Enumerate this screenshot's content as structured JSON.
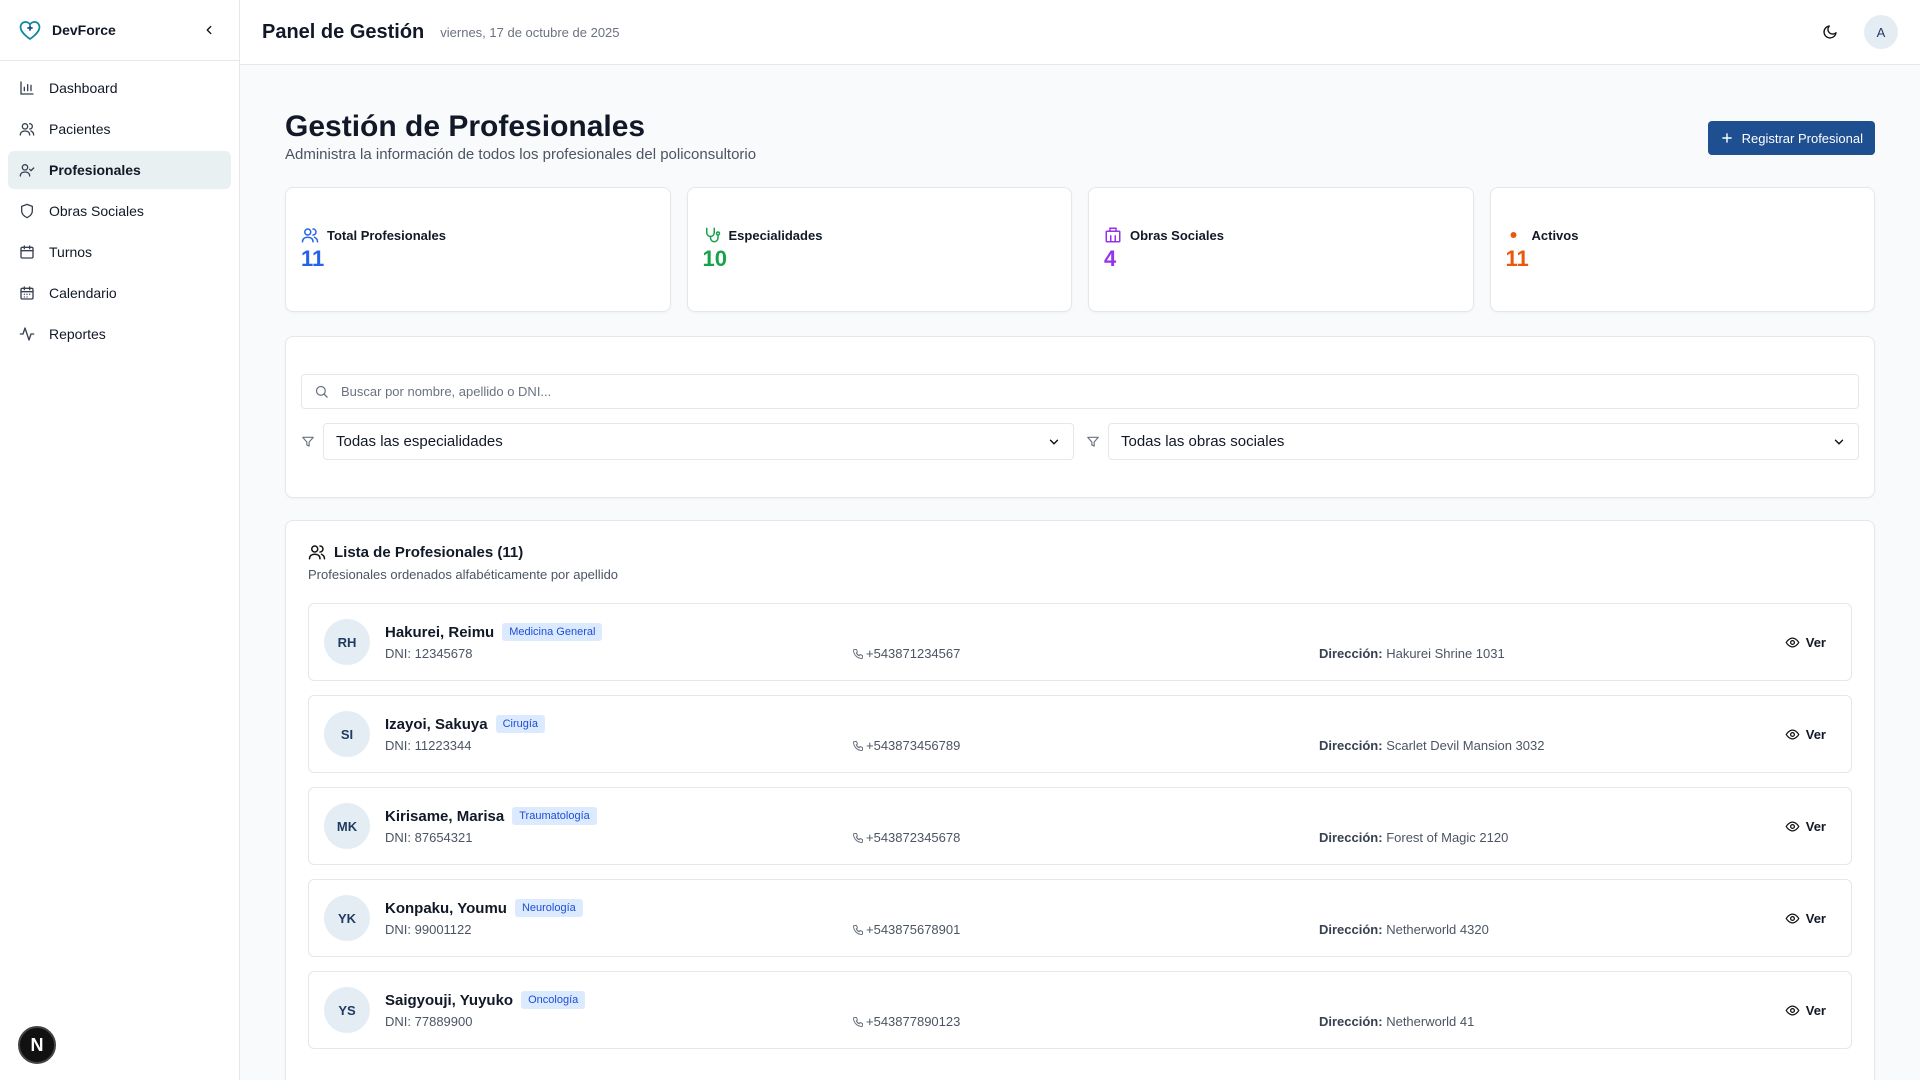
{
  "app": {
    "name": "DevForce"
  },
  "sidebar": {
    "items": [
      {
        "label": "Dashboard",
        "icon": "bar-chart-icon"
      },
      {
        "label": "Pacientes",
        "icon": "users-icon"
      },
      {
        "label": "Profesionales",
        "icon": "user-check-icon",
        "active": true
      },
      {
        "label": "Obras Sociales",
        "icon": "shield-icon"
      },
      {
        "label": "Turnos",
        "icon": "calendar-icon"
      },
      {
        "label": "Calendario",
        "icon": "calendar-days-icon"
      },
      {
        "label": "Reportes",
        "icon": "activity-icon"
      }
    ],
    "fab_label": "N"
  },
  "header": {
    "title": "Panel de Gestión",
    "date": "viernes, 17 de octubre de 2025",
    "avatar": "A"
  },
  "page": {
    "title": "Gestión de Profesionales",
    "subtitle": "Administra la información de todos los profesionales del policonsultorio",
    "primary_button": "Registrar Profesional"
  },
  "stats": [
    {
      "label": "Total Profesionales",
      "value": "11",
      "color": "#2563eb"
    },
    {
      "label": "Especialidades",
      "value": "10",
      "color": "#16a34a"
    },
    {
      "label": "Obras Sociales",
      "value": "4",
      "color": "#9333ea"
    },
    {
      "label": "Activos",
      "value": "11",
      "color": "#ea580c"
    }
  ],
  "filters": {
    "search_placeholder": "Buscar por nombre, apellido o DNI...",
    "specialty": "Todas las especialidades",
    "insurance": "Todas las obras sociales"
  },
  "list": {
    "title": "Lista de Profesionales (11)",
    "subtitle": "Profesionales ordenados alfabéticamente por apellido",
    "dni_label": "DNI:",
    "address_label": "Dirección:",
    "view_label": "Ver",
    "rows": [
      {
        "initials": "RH",
        "name": "Hakurei, Reimu",
        "specialty": "Medicina General",
        "dni": "12345678",
        "phone": "+543871234567",
        "address": "Hakurei Shrine 1031"
      },
      {
        "initials": "SI",
        "name": "Izayoi, Sakuya",
        "specialty": "Cirugía",
        "dni": "11223344",
        "phone": "+543873456789",
        "address": "Scarlet Devil Mansion 3032"
      },
      {
        "initials": "MK",
        "name": "Kirisame, Marisa",
        "specialty": "Traumatología",
        "dni": "87654321",
        "phone": "+543872345678",
        "address": "Forest of Magic 2120"
      },
      {
        "initials": "YK",
        "name": "Konpaku, Youmu",
        "specialty": "Neurología",
        "dni": "99001122",
        "phone": "+543875678901",
        "address": "Netherworld 4320"
      },
      {
        "initials": "YS",
        "name": "Saigyouji, Yuyuko",
        "specialty": "Oncología",
        "dni": "77889900",
        "phone": "+543877890123",
        "address": "Netherworld 41"
      }
    ]
  }
}
